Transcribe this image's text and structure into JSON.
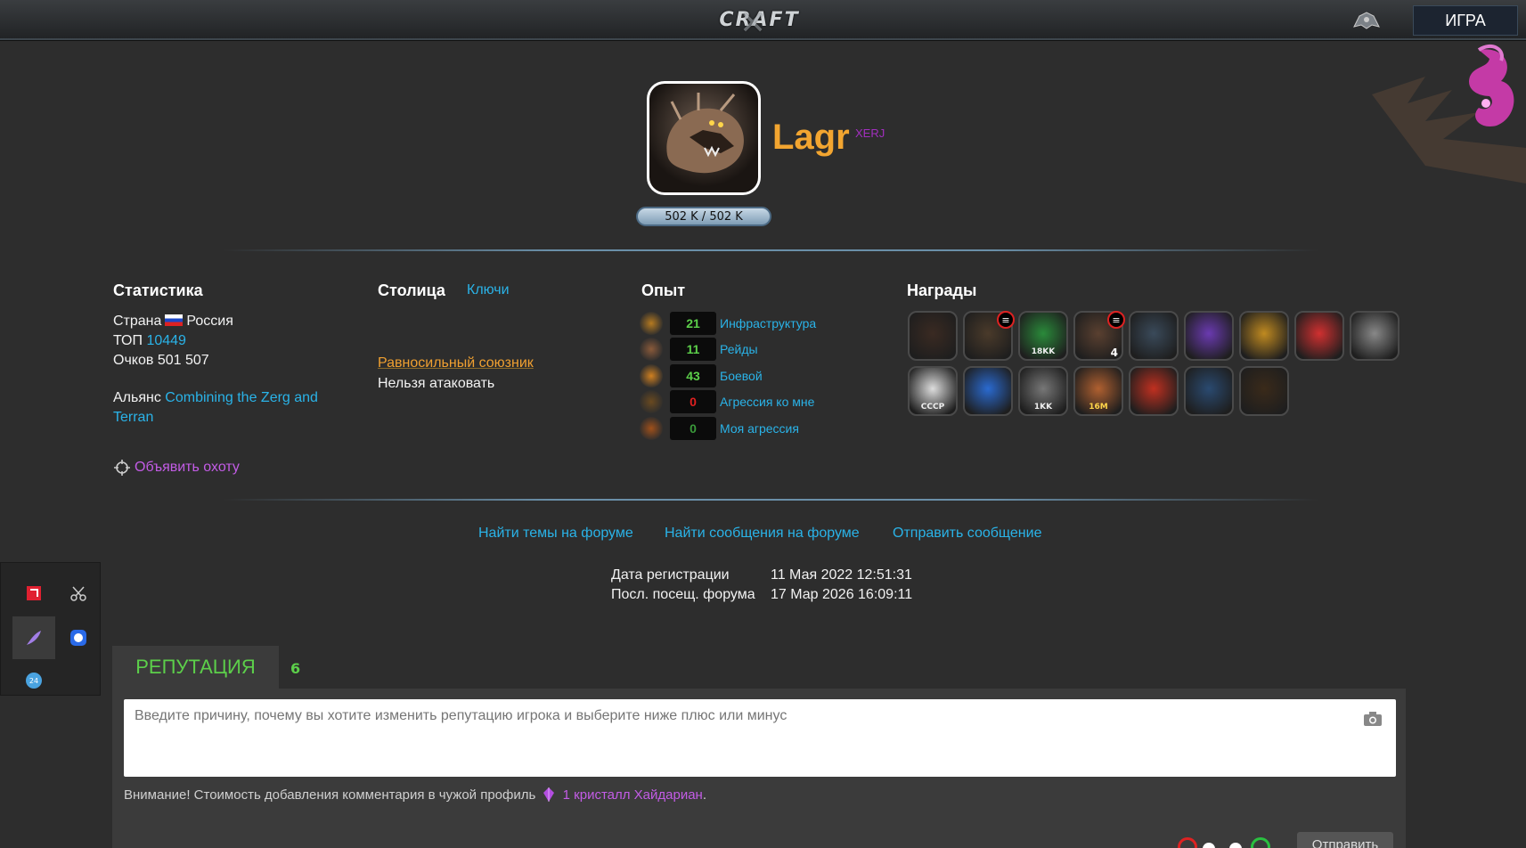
{
  "header": {
    "logo_text": "CRAFT",
    "game_button": "ИГРА",
    "ship_icon": "ship-icon"
  },
  "profile": {
    "name": "Lagr",
    "race": "XERJ",
    "hp_text": "502 K / 502 K",
    "name_color": "#f2a530",
    "race_color": "#a22fbf"
  },
  "stats": {
    "heading": "Статистика",
    "country_label": "Страна",
    "country": "Россия",
    "top_label": "ТОП",
    "top_value": "10449",
    "points_label": "Очков",
    "points_value": "501 507",
    "alliance_label": "Альянс",
    "alliance_line1": "Combining the Zerg and",
    "alliance_line2": "Terran",
    "hunt_label": "Объявить охоту"
  },
  "capital": {
    "heading": "Столица",
    "keys_link": "Ключи",
    "ally_link": "Равносильный союзник",
    "no_attack": "Нельзя атаковать"
  },
  "experience": {
    "heading": "Опыт",
    "rows": [
      {
        "value": "21",
        "label": "Инфраструктура",
        "color": "#5ccf4a"
      },
      {
        "value": "11",
        "label": "Рейды",
        "color": "#5ccf4a"
      },
      {
        "value": "43",
        "label": "Боевой",
        "color": "#5ccf4a"
      },
      {
        "value": "0",
        "label": "Агрессия ко мне",
        "color": "#e02020"
      },
      {
        "value": "0",
        "label": "Моя агрессия",
        "color": "#3a9a3a"
      }
    ]
  },
  "awards": {
    "heading": "Награды",
    "items": [
      {
        "icon": "red-eye-award-icon"
      },
      {
        "icon": "zerg-creature-award-icon"
      },
      {
        "icon": "green-emblem-award-icon",
        "caption": "18KK"
      },
      {
        "icon": "zerg-larva-award-icon",
        "count": "4"
      },
      {
        "icon": "blue-mech-award-icon"
      },
      {
        "icon": "purple-vortex-award-icon"
      },
      {
        "icon": "gold-coins-award-icon"
      },
      {
        "icon": "red-santa-award-icon"
      },
      {
        "icon": "claw-scratch-award-icon"
      },
      {
        "icon": "cosmonaut-award-icon",
        "caption": "СССР"
      },
      {
        "icon": "blue-ghost-award-icon"
      },
      {
        "icon": "gray-emblem-award-icon",
        "caption": "1KK"
      },
      {
        "icon": "explosion-16m-award-icon",
        "caption": "16M"
      },
      {
        "icon": "fruit-award-icon"
      },
      {
        "icon": "fighter-ship-award-icon"
      },
      {
        "icon": "egg-award-icon"
      }
    ]
  },
  "forum": {
    "find_topics": "Найти темы на форуме",
    "find_posts": "Найти сообщения на форуме",
    "send_message": "Отправить сообщение",
    "reg_label": "Дата регистрации",
    "reg_value": "11 Мая 2022 12:51:31",
    "last_visit_label": "Посл. посещ. форума",
    "last_visit_value": "17 Мар 2026 16:09:11"
  },
  "reputation": {
    "tab_label": "РЕПУТАЦИЯ",
    "count": "6",
    "input_placeholder": "Введите причину, почему вы хотите изменить репутацию игрока и выберите ниже плюс или минус",
    "warning_prefix": "Внимание! Стоимость добавления комментария в чужой профиль",
    "warning_cost": "1 кристалл Хайдариан",
    "warning_suffix": ".",
    "send_button": "Отправить"
  }
}
